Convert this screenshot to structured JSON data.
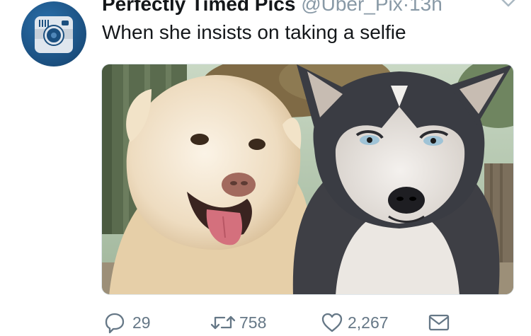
{
  "tweet": {
    "display_name": "Perfectly Timed Pics",
    "handle": "@Uber_Pix",
    "separator": "·",
    "timestamp": "13h",
    "text": "When she insists on taking a selfie"
  },
  "actions": {
    "reply_count": "29",
    "retweet_count": "758",
    "like_count": "2,267"
  },
  "icons": {
    "avatar": "camera-icon",
    "menu": "chevron-down-icon",
    "reply": "reply-icon",
    "retweet": "retweet-icon",
    "like": "heart-icon",
    "dm": "envelope-icon"
  },
  "colors": {
    "text": "#14171a",
    "muted": "#8899a6",
    "counts": "#657786",
    "avatar_bg": "#1b4f7f"
  }
}
